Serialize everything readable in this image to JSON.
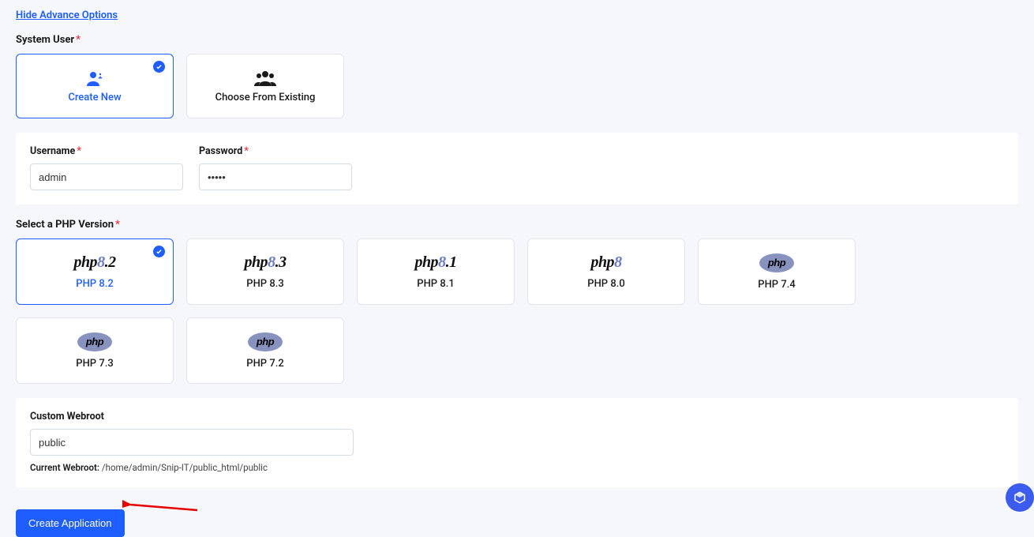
{
  "link_advance": "Hide Advance Options",
  "system_user": {
    "label": "System User",
    "create_new": "Create New",
    "choose_existing": "Choose From Existing"
  },
  "credentials": {
    "username_label": "Username",
    "username_value": "admin",
    "password_label": "Password",
    "password_value": "•••••"
  },
  "php_section": {
    "label": "Select a PHP Version",
    "versions": [
      {
        "logo": "php8.2",
        "label": "PHP 8.2",
        "selected": true
      },
      {
        "logo": "php8.3",
        "label": "PHP 8.3",
        "selected": false
      },
      {
        "logo": "php8.1",
        "label": "PHP 8.1",
        "selected": false
      },
      {
        "logo": "php8",
        "label": "PHP 8.0",
        "selected": false
      },
      {
        "logo": "oval",
        "label": "PHP 7.4",
        "selected": false
      },
      {
        "logo": "oval",
        "label": "PHP 7.3",
        "selected": false
      },
      {
        "logo": "oval",
        "label": "PHP 7.2",
        "selected": false
      }
    ]
  },
  "webroot": {
    "label": "Custom Webroot",
    "value": "public",
    "helper_label": "Current Webroot:",
    "helper_path": "/home/admin/Snip-IT/public_html/public"
  },
  "create_button": "Create Application"
}
